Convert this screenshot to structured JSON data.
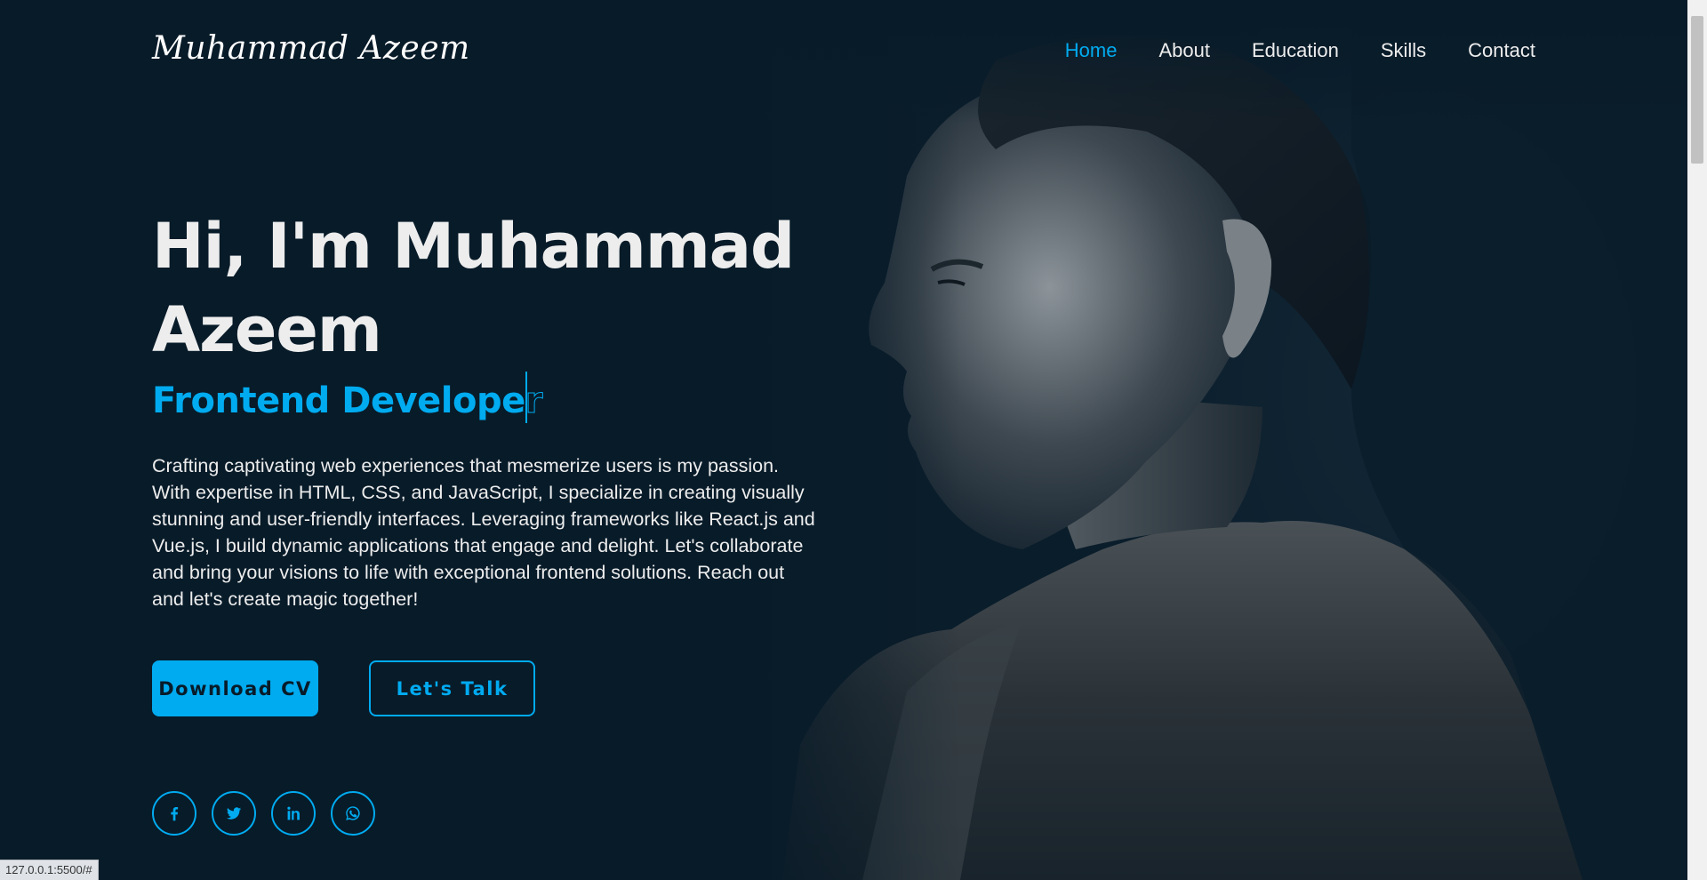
{
  "header": {
    "logo": "Muhammad Azeem",
    "nav": [
      {
        "label": "Home",
        "active": true
      },
      {
        "label": "About",
        "active": false
      },
      {
        "label": "Education",
        "active": false
      },
      {
        "label": "Skills",
        "active": false
      },
      {
        "label": "Contact",
        "active": false
      }
    ]
  },
  "hero": {
    "heading": "Hi, I'm Muhammad Azeem",
    "role_typed": "Frontend Develope",
    "role_pending": "r",
    "description": "Crafting captivating web experiences that mesmerize users is my passion. With expertise in HTML, CSS, and JavaScript, I specialize in creating visually stunning and user-friendly interfaces. Leveraging frameworks like React.js and Vue.js, I build dynamic applications that engage and delight. Let's collaborate and bring your visions to life with exceptional frontend solutions. Reach out and let's create magic together!",
    "buttons": {
      "download_cv": "Download CV",
      "lets_talk": "Let's Talk"
    }
  },
  "socials": [
    {
      "icon": "facebook-icon"
    },
    {
      "icon": "twitter-icon"
    },
    {
      "icon": "linkedin-icon"
    },
    {
      "icon": "whatsapp-icon"
    }
  ],
  "status_url": "127.0.0.1:5500/#",
  "colors": {
    "background": "#081b29",
    "accent": "#00abf0",
    "text": "#ededed"
  }
}
